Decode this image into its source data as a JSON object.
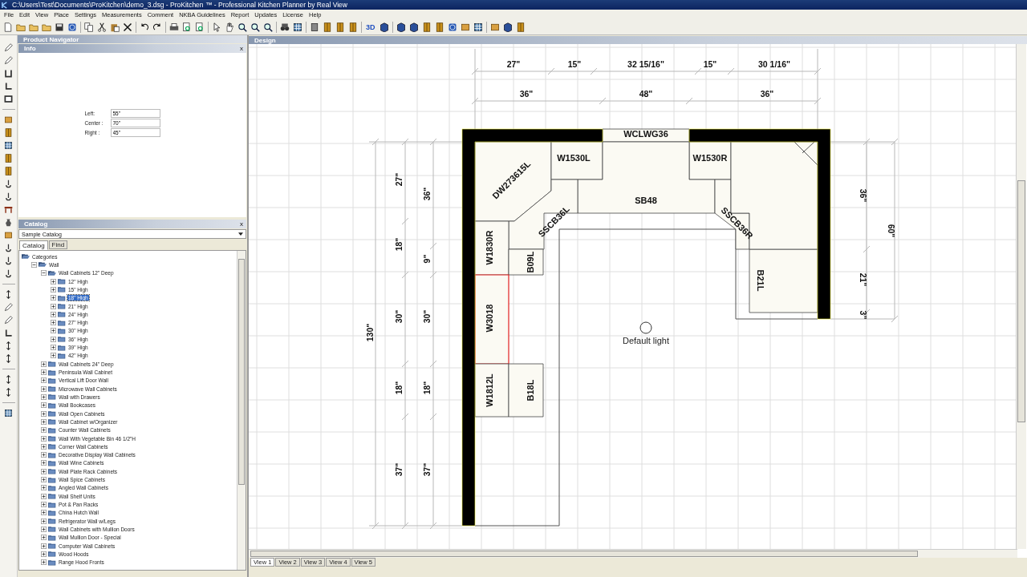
{
  "window": {
    "title": "C:\\Users\\Test\\Documents\\ProKitchen\\demo_3.dsg - ProKitchen ™ - Professional Kitchen Planner by Real View"
  },
  "menu": [
    "File",
    "Edit",
    "View",
    "Place",
    "Settings",
    "Measurements",
    "Comment",
    "NKBA Guidelines",
    "Report",
    "Updates",
    "License",
    "Help"
  ],
  "toolbar": {
    "view_3d_label": "3D"
  },
  "product_navigator": {
    "title": "Product Navigator"
  },
  "info": {
    "title": "Info",
    "close": "x",
    "fields": [
      {
        "label": "Left:",
        "value": "55\""
      },
      {
        "label": "Center :",
        "value": "70\""
      },
      {
        "label": "Right :",
        "value": "45\""
      }
    ]
  },
  "catalog": {
    "title": "Catalog",
    "close": "x",
    "dropdown": "Sample Catalog",
    "tabs": [
      {
        "label": "Catalog",
        "selected": true
      },
      {
        "label": "Find",
        "selected": false
      }
    ],
    "tree": [
      {
        "label": "Categories",
        "expanded": true,
        "selected": false,
        "children": [
          {
            "label": "Wall",
            "expanded": true,
            "selected": false,
            "children": [
              {
                "label": "Wall Cabinets 12\" Deep",
                "expanded": true,
                "selected": false,
                "children": [
                  {
                    "label": "12\" High",
                    "expanded": false,
                    "selected": false
                  },
                  {
                    "label": "15\" High",
                    "expanded": false,
                    "selected": false
                  },
                  {
                    "label": "18\" High",
                    "expanded": false,
                    "selected": true
                  },
                  {
                    "label": "21\" High",
                    "expanded": false,
                    "selected": false
                  },
                  {
                    "label": "24\" High",
                    "expanded": false,
                    "selected": false
                  },
                  {
                    "label": "27\" High",
                    "expanded": false,
                    "selected": false
                  },
                  {
                    "label": "30\" High",
                    "expanded": false,
                    "selected": false
                  },
                  {
                    "label": "36\" High",
                    "expanded": false,
                    "selected": false
                  },
                  {
                    "label": "39\" High",
                    "expanded": false,
                    "selected": false
                  },
                  {
                    "label": "42\" High",
                    "expanded": false,
                    "selected": false
                  }
                ]
              },
              {
                "label": "Wall Cabinets 24\" Deep",
                "expanded": false,
                "selected": false
              },
              {
                "label": "Peninsula Wall Cabinet",
                "expanded": false,
                "selected": false
              },
              {
                "label": "Vertical Lift Door Wall",
                "expanded": false,
                "selected": false
              },
              {
                "label": "Microwave Wall Cabinets",
                "expanded": false,
                "selected": false
              },
              {
                "label": "Wall with Drawers",
                "expanded": false,
                "selected": false
              },
              {
                "label": "Wall Bookcases",
                "expanded": false,
                "selected": false
              },
              {
                "label": "Wall Open Cabinets",
                "expanded": false,
                "selected": false
              },
              {
                "label": "Wall Cabinet w/Organizer",
                "expanded": false,
                "selected": false
              },
              {
                "label": "Counter Wall Cabinets",
                "expanded": false,
                "selected": false
              },
              {
                "label": "Wall With Vegetable Bin 46 1/2\"H",
                "expanded": false,
                "selected": false
              },
              {
                "label": "Corner Wall Cabinets",
                "expanded": false,
                "selected": false
              },
              {
                "label": "Decorative Display Wall Cabinets",
                "expanded": false,
                "selected": false
              },
              {
                "label": "Wall Wine Cabinets",
                "expanded": false,
                "selected": false
              },
              {
                "label": "Wall Plate Rack Cabinets",
                "expanded": false,
                "selected": false
              },
              {
                "label": "Wall Spice Cabinets",
                "expanded": false,
                "selected": false
              },
              {
                "label": "Angled Wall Cabinets",
                "expanded": false,
                "selected": false
              },
              {
                "label": "Wall Shelf Units",
                "expanded": false,
                "selected": false
              },
              {
                "label": "Pot & Pan Racks",
                "expanded": false,
                "selected": false
              },
              {
                "label": "China Hutch Wall",
                "expanded": false,
                "selected": false
              },
              {
                "label": "Refrigerator Wall w/Legs",
                "expanded": false,
                "selected": false
              },
              {
                "label": "Wall Cabinets with Mullion Doors",
                "expanded": false,
                "selected": false
              },
              {
                "label": "Wall Mullion Door - Special",
                "expanded": false,
                "selected": false
              },
              {
                "label": "Computer Wall Cabinets",
                "expanded": false,
                "selected": false
              },
              {
                "label": "Wood Hoods",
                "expanded": false,
                "selected": false
              },
              {
                "label": "Range Hood Fronts",
                "expanded": false,
                "selected": false
              }
            ]
          }
        ]
      }
    ]
  },
  "design": {
    "title": "Design",
    "cabinets": [
      {
        "label": "WCLWG36",
        "selected": false
      },
      {
        "label": "DW273615L",
        "selected": false
      },
      {
        "label": "W1530L",
        "selected": false
      },
      {
        "label": "W1530R",
        "selected": false
      },
      {
        "label": "SB48",
        "selected": false
      },
      {
        "label": "SSCB36L",
        "selected": false
      },
      {
        "label": "SSCB36R",
        "selected": false
      },
      {
        "label": "W1830R",
        "selected": false
      },
      {
        "label": "B09L",
        "selected": false
      },
      {
        "label": "B21L",
        "selected": false
      },
      {
        "label": "W3018",
        "selected": true
      },
      {
        "label": "W1812L",
        "selected": false
      },
      {
        "label": "B18L",
        "selected": false
      }
    ],
    "dimensions": {
      "top_row_1": [
        "27\"",
        "15\"",
        "32 15/16\"",
        "15\"",
        "30 1/16\""
      ],
      "top_row_2": [
        "36\"",
        "48\"",
        "36\""
      ],
      "left_outer": [
        "130\""
      ],
      "left_col_1": [
        "27\"",
        "18\"",
        "30\"",
        "18\"",
        "37\""
      ],
      "left_col_2": [
        "36\"",
        "9\"",
        "30\"",
        "18\"",
        "37\""
      ],
      "right_col_1": [
        "36\"",
        "21\"",
        "3\""
      ],
      "right_col_2": [
        "60\""
      ]
    },
    "light": {
      "label": "Default light"
    }
  },
  "view_tabs": [
    {
      "label": "View 1",
      "selected": true
    },
    {
      "label": "View 2",
      "selected": false
    },
    {
      "label": "View 3",
      "selected": false
    },
    {
      "label": "View 4",
      "selected": false
    },
    {
      "label": "View 5",
      "selected": false
    }
  ]
}
